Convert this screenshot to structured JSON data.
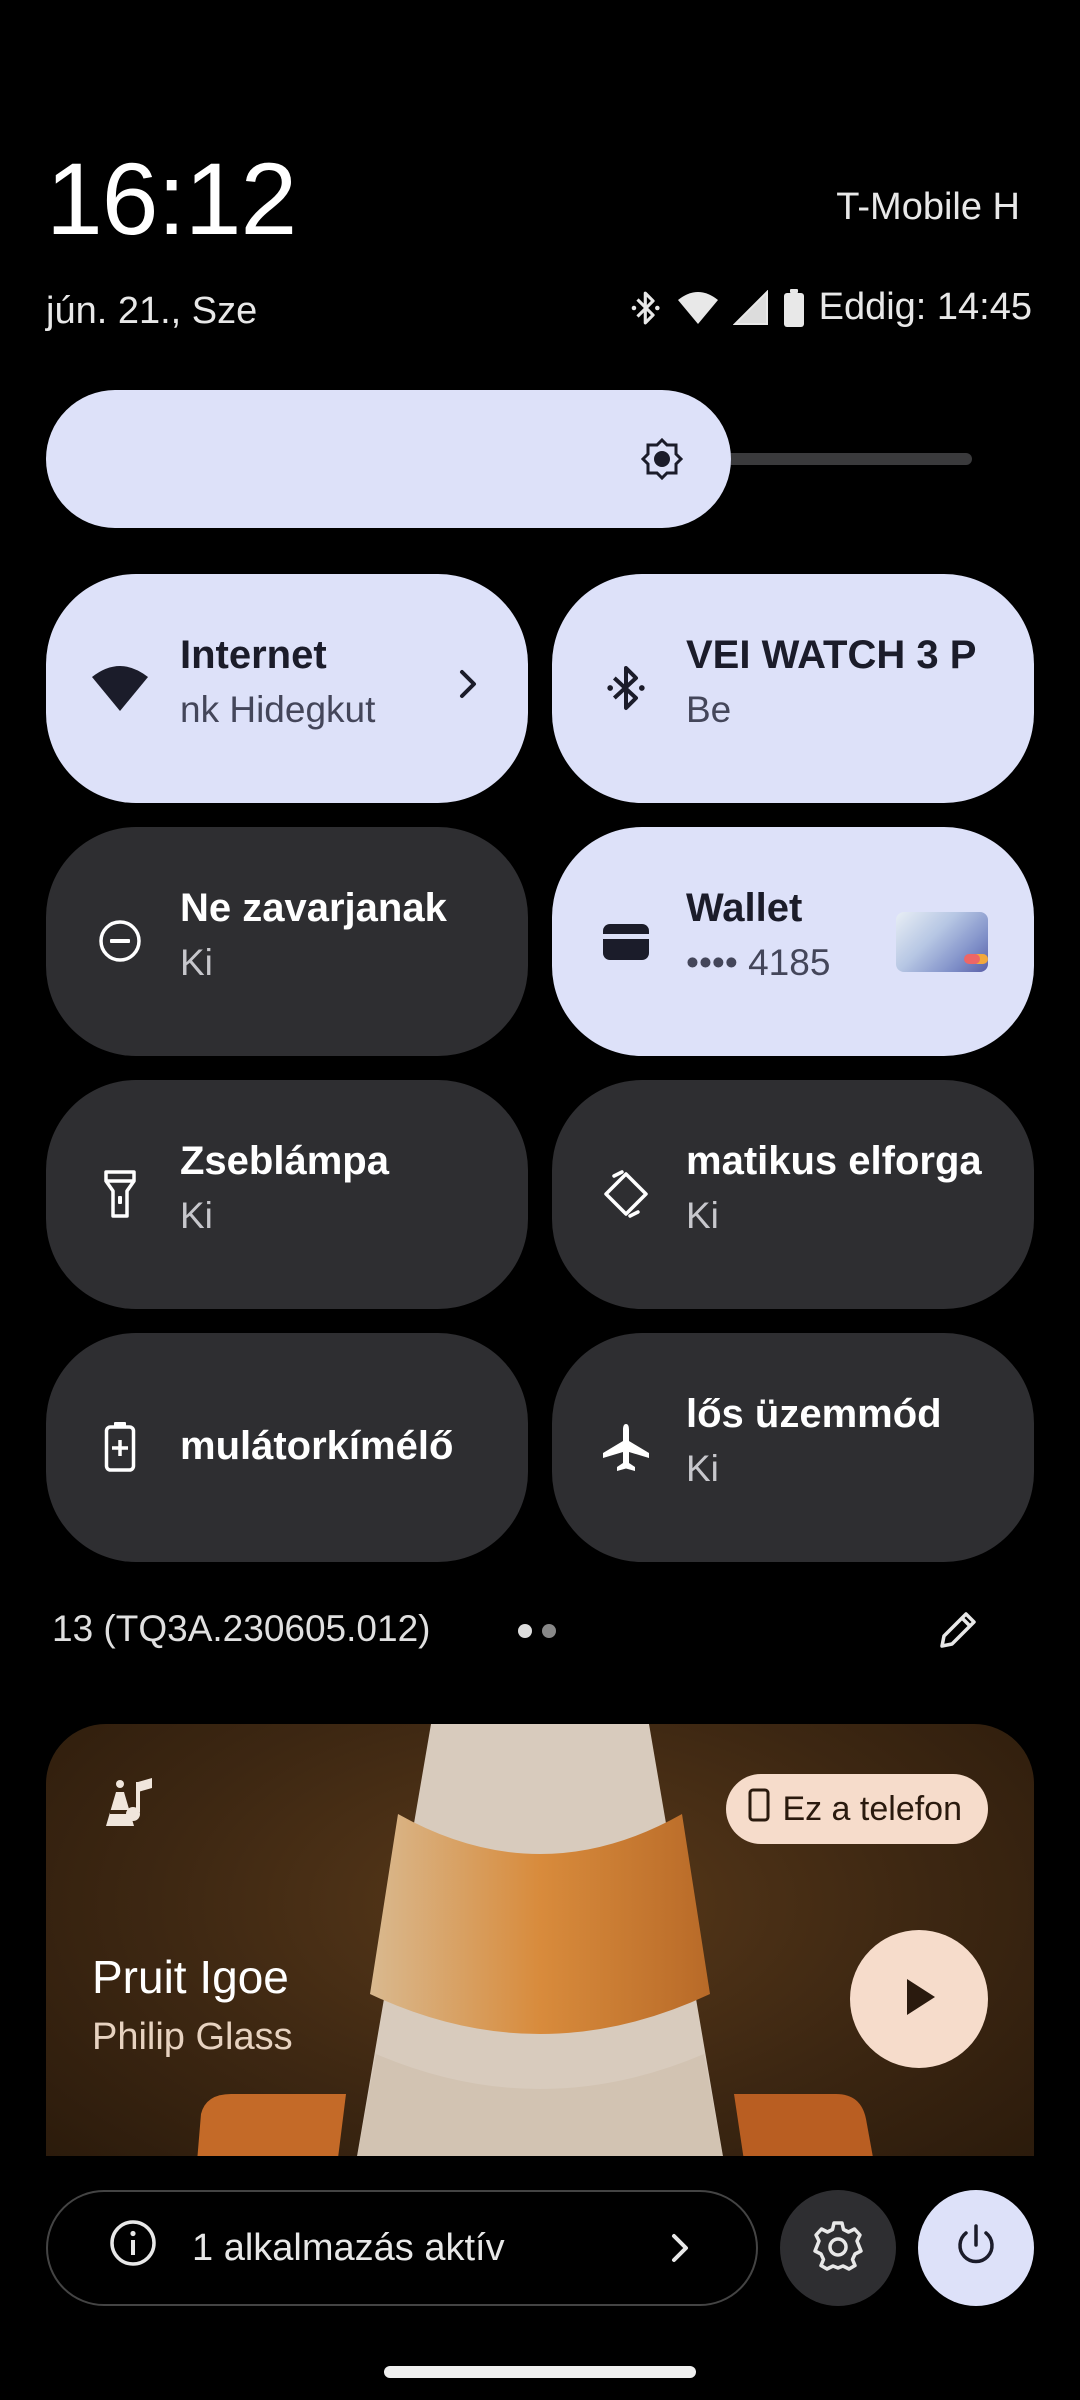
{
  "header": {
    "time": "16:12",
    "carrier": "T-Mobile H",
    "date": "jún. 21., Sze",
    "battery_text": "Eddig: 14:45",
    "status_icons": [
      "bluetooth-icon",
      "wifi-icon",
      "signal-icon",
      "battery-icon"
    ]
  },
  "brightness": {
    "level": 0.74,
    "icon": "brightness-icon"
  },
  "tiles": [
    {
      "label": "Internet",
      "sub": "nk Hidegkut",
      "state": "on",
      "icon": "wifi-icon"
    },
    {
      "label": "VEI WATCH 3 P",
      "sub": "Be",
      "state": "on",
      "icon": "bluetooth-icon"
    },
    {
      "label": "Ne zavarjanak",
      "sub": "Ki",
      "state": "off",
      "icon": "do-not-disturb-icon"
    },
    {
      "label": "Wallet",
      "sub": "•••• 4185",
      "state": "on",
      "icon": "wallet-icon"
    },
    {
      "label": "Zseblámpa",
      "sub": "Ki",
      "state": "off",
      "icon": "flashlight-icon"
    },
    {
      "label": "matikus elforga",
      "sub": "Ki",
      "state": "off",
      "icon": "auto-rotate-icon"
    },
    {
      "label": "mulátorkímélő",
      "sub": "",
      "state": "off",
      "icon": "battery-saver-icon"
    },
    {
      "label": "lős üzemmód",
      "sub": "Ki",
      "state": "off",
      "icon": "airplane-icon"
    }
  ],
  "footer": {
    "build": "13 (TQ3A.230605.012)",
    "page_count": 2,
    "current_page": 1
  },
  "media": {
    "song": "Pruit Igoe",
    "artist": "Philip Glass",
    "output_device": "Ez a telefon",
    "app_icon": "vlc-icon",
    "colors": {
      "chip": "#f6dccb",
      "background": "#3d2712"
    }
  },
  "bottom": {
    "active_apps": "1 alkalmazás aktív"
  },
  "colors": {
    "tile_on": "#dde1f9",
    "tile_off": "#2e2e31",
    "background": "#000000"
  }
}
